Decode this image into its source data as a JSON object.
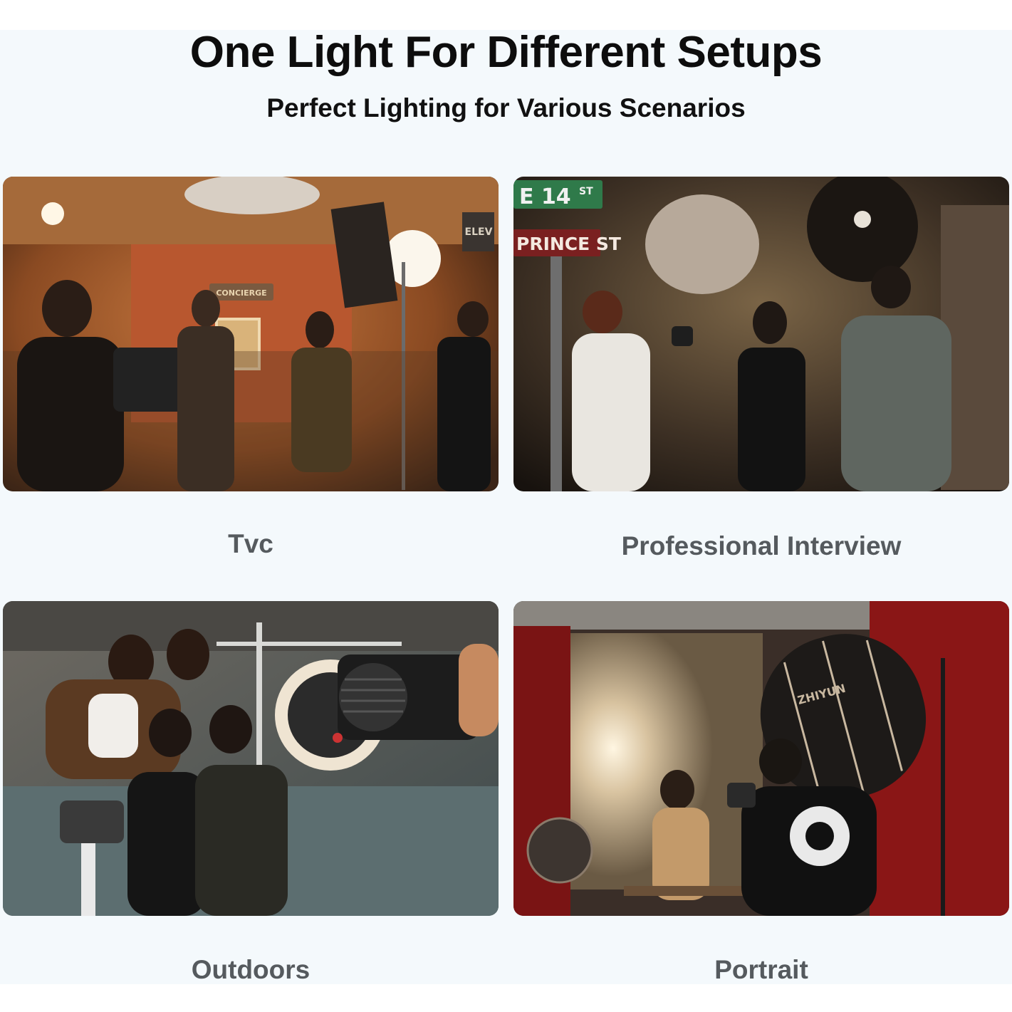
{
  "header": {
    "title": "One Light For Different Setups",
    "subtitle": "Perfect Lighting for Various Scenarios"
  },
  "scenarios": [
    {
      "label": "Tvc",
      "image_icon": "film-set-photo"
    },
    {
      "label": "Professional Interview",
      "image_icon": "street-interview-photo"
    },
    {
      "label": "Outdoors",
      "image_icon": "group-selfie-photo"
    },
    {
      "label": "Portrait",
      "image_icon": "studio-portrait-photo"
    }
  ],
  "photo_text": {
    "concierge": "CONCIERGE",
    "elev": "ELEV",
    "street_1": "E 14",
    "street_1_suffix": "ST",
    "street_2": "PRINCE ST",
    "softbox_brand": "ZHIYUN"
  },
  "colors": {
    "background": "#f4f9fc",
    "title": "#0d0d0d",
    "caption": "#555a5e"
  }
}
